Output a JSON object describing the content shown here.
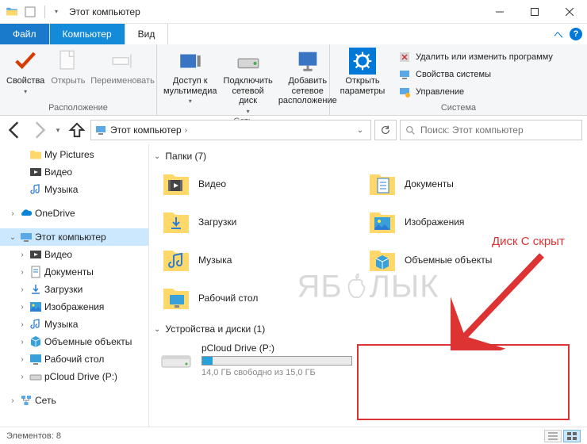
{
  "window": {
    "title": "Этот компьютер"
  },
  "tabs": {
    "file": "Файл",
    "computer": "Компьютер",
    "view": "Вид"
  },
  "ribbon": {
    "groups": {
      "location": {
        "label": "Расположение",
        "properties": "Свойства",
        "open": "Открыть",
        "rename": "Переименовать"
      },
      "network": {
        "label": "Сеть",
        "media_access": "Доступ к мультимедиа",
        "map_drive": "Подключить сетевой диск",
        "add_network": "Добавить сетевое расположение"
      },
      "system": {
        "label": "Система",
        "open_params": "Открыть параметры",
        "uninstall": "Удалить или изменить программу",
        "sys_props": "Свойства системы",
        "manage": "Управление"
      }
    }
  },
  "address": {
    "location": "Этот компьютер",
    "search_placeholder": "Поиск: Этот компьютер"
  },
  "nav": {
    "my_pictures": "My Pictures",
    "video": "Видео",
    "music": "Музыка",
    "onedrive": "OneDrive",
    "this_pc": "Этот компьютер",
    "pc_video": "Видео",
    "pc_documents": "Документы",
    "pc_downloads": "Загрузки",
    "pc_pictures": "Изображения",
    "pc_music": "Музыка",
    "pc_3d": "Объемные объекты",
    "pc_desktop": "Рабочий стол",
    "pc_pcloud": "pCloud Drive (P:)",
    "network": "Сеть"
  },
  "content": {
    "folders_header": "Папки (7)",
    "drives_header": "Устройства и диски (1)",
    "folders": {
      "video": "Видео",
      "documents": "Документы",
      "downloads": "Загрузки",
      "pictures": "Изображения",
      "music": "Музыка",
      "objects3d": "Объемные объекты",
      "desktop": "Рабочий стол"
    },
    "drive": {
      "name": "pCloud Drive (P:)",
      "free_text": "14,0 ГБ свободно из 15,0 ГБ",
      "used_pct": 7
    }
  },
  "status": {
    "items_label": "Элементов:",
    "count": "8"
  },
  "annotation": {
    "text": "Диск С скрыт"
  },
  "watermark": {
    "prefix": "ЯБ",
    "suffix": "ЛЫК"
  }
}
